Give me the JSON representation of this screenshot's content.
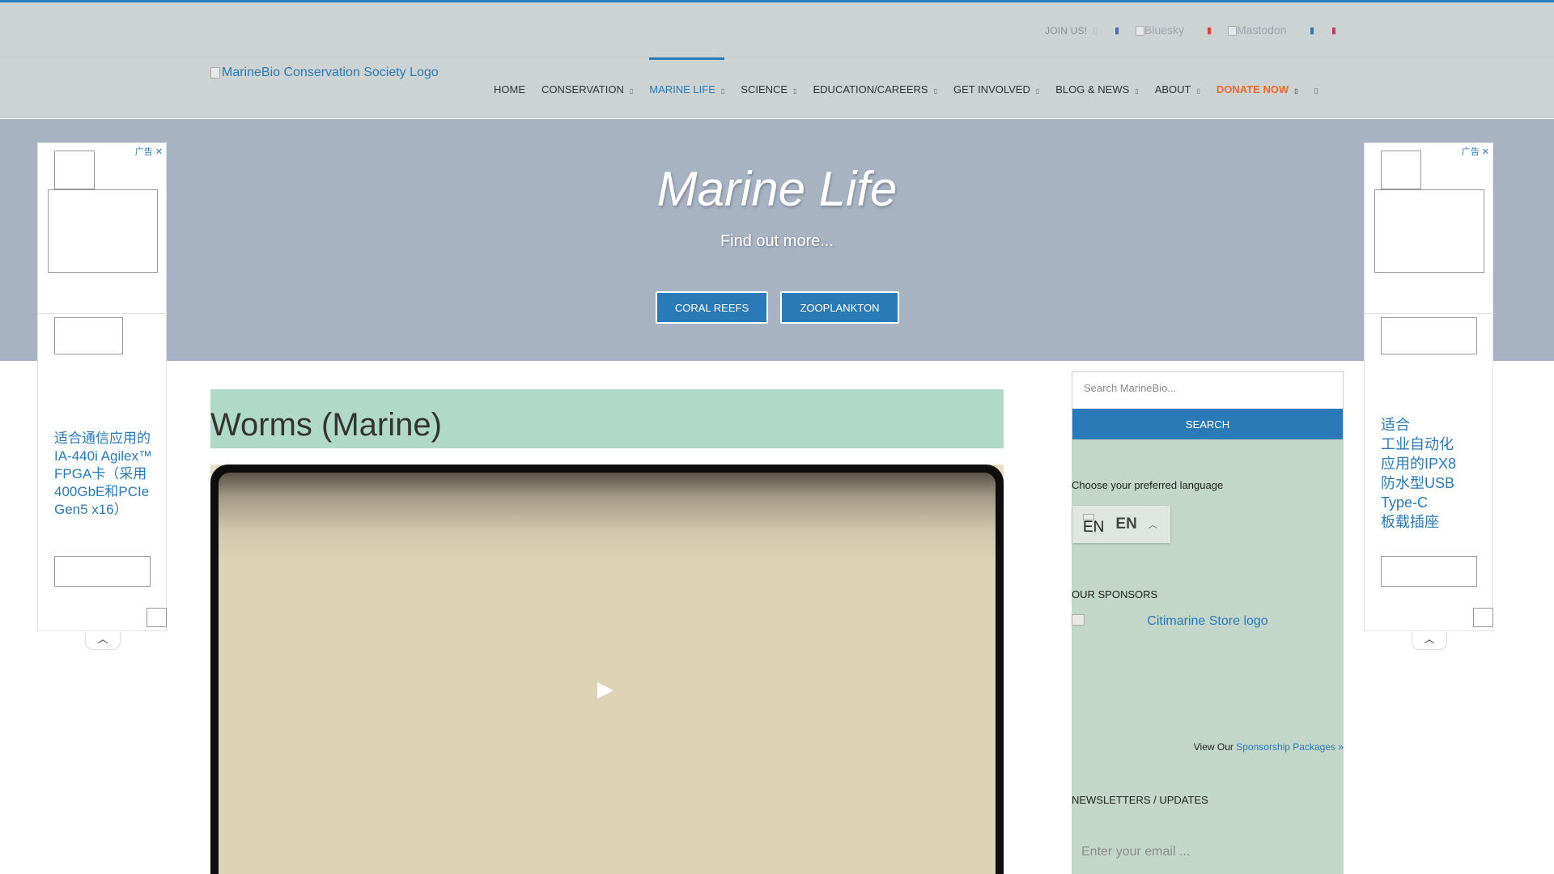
{
  "topbar": {
    "join_label": "JOIN US!",
    "bluesky_alt": "Bluesky",
    "mastodon_alt": "Mastodon"
  },
  "header": {
    "logo_alt": "MarineBio Conservation Society Logo",
    "nav": [
      {
        "label": "HOME"
      },
      {
        "label": "CONSERVATION"
      },
      {
        "label": "MARINE LIFE"
      },
      {
        "label": "SCIENCE"
      },
      {
        "label": "EDUCATION/CAREERS"
      },
      {
        "label": "GET INVOLVED"
      },
      {
        "label": "BLOG & NEWS"
      },
      {
        "label": "ABOUT"
      },
      {
        "label": "DONATE NOW"
      }
    ]
  },
  "hero": {
    "title": "Marine Life",
    "subtitle": "Find out more...",
    "buttons": [
      {
        "label": "CORAL REEFS"
      },
      {
        "label": "ZOOPLANKTON"
      }
    ]
  },
  "ads": {
    "tag": "广告",
    "close": "✕",
    "left_text": "适合通信应用的IA-440i Agilex™ FPGA卡（采用400GbE和PCIe Gen5 x16）",
    "right_text_lines": [
      "适合",
      "工业自动化",
      "应用的IPX8",
      "防水型USB",
      "Type-C",
      "板载插座"
    ]
  },
  "main": {
    "page_title": "Worms (Marine)"
  },
  "sidebar": {
    "search_placeholder": "Search MarineBio...",
    "search_button": "SEARCH",
    "language_label": "Choose your preferred language",
    "language_flag_alt": "EN",
    "language_code": "EN",
    "sponsors_heading": "OUR SPONSORS",
    "sponsor_logo_alt": "Citimarine Store logo",
    "view_our": "View Our",
    "sponsorship_link": "Sponsorship Packages »",
    "newsletter_heading": "NEWSLETTERS / UPDATES",
    "email_placeholder": "Enter your email ..."
  },
  "colors": {
    "accent": "#2a7ab8",
    "donate": "#e86a2a",
    "hero_bg": "#a7b2c3",
    "title_box": "#b1d9ca",
    "sidebar_bg": "#c2d6c9"
  }
}
